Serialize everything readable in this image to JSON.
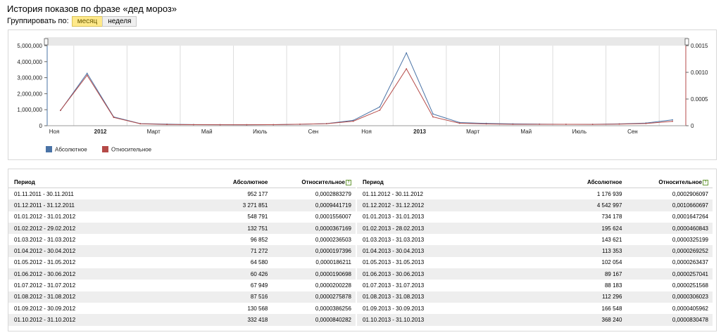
{
  "page": {
    "title": "История показов по фразе «дед мороз»",
    "group_label": "Группировать по:",
    "group_month": "месяц",
    "group_week": "неделя"
  },
  "legend": {
    "absolute": "Абсолютное",
    "relative": "Относительное"
  },
  "colors": {
    "absolute": "#4a73a6",
    "relative": "#b54a48",
    "active_button": "#ffe98a"
  },
  "chart_data": {
    "type": "line",
    "x": [
      "2011-11",
      "2011-12",
      "2012-01",
      "2012-02",
      "2012-03",
      "2012-04",
      "2012-05",
      "2012-06",
      "2012-07",
      "2012-08",
      "2012-09",
      "2012-10",
      "2012-11",
      "2012-12",
      "2013-01",
      "2013-02",
      "2013-03",
      "2013-04",
      "2013-05",
      "2013-06",
      "2013-07",
      "2013-08",
      "2013-09",
      "2013-10"
    ],
    "x_tick_labels": [
      "Ноя",
      "2012",
      "Март",
      "Май",
      "Июль",
      "Сен",
      "Ноя",
      "2013",
      "Март",
      "Май",
      "Июль",
      "Сен"
    ],
    "y_left_ticks": [
      "0",
      "1,000,000",
      "2,000,000",
      "3,000,000",
      "4,000,000",
      "5,000,000"
    ],
    "y_right_ticks": [
      "0",
      "0.0005",
      "0.0010",
      "0.0015"
    ],
    "y_left_range": [
      0,
      5000000
    ],
    "y_right_range": [
      0,
      0.0015
    ],
    "series": [
      {
        "name": "Абсолютное",
        "axis": "left",
        "values": [
          952177,
          3271851,
          548791,
          132751,
          96852,
          71272,
          64580,
          60426,
          67949,
          87516,
          130568,
          332418,
          1176939,
          4542997,
          734178,
          195624,
          143621,
          113353,
          102054,
          89167,
          88183,
          112296,
          166548,
          368240
        ]
      },
      {
        "name": "Относительное",
        "axis": "right",
        "values": [
          0.0002883279,
          0.0009441719,
          0.0001556007,
          3.67169e-05,
          2.36503e-05,
          1.97396e-05,
          1.86211e-05,
          1.90698e-05,
          2.00228e-05,
          2.75878e-05,
          3.86256e-05,
          8.40282e-05,
          0.0002906097,
          0.0010660697,
          0.0001647264,
          4.60843e-05,
          3.25199e-05,
          2.69252e-05,
          2.63437e-05,
          2.57041e-05,
          2.51568e-05,
          3.06023e-05,
          4.05962e-05,
          8.30478e-05
        ]
      }
    ],
    "grid": true,
    "legend_position": "bottom-left"
  },
  "table": {
    "headers": {
      "period": "Период",
      "absolute": "Абсолютное",
      "relative": "Относительное"
    },
    "left": [
      [
        "01.11.2011 - 30.11.2011",
        "952 177",
        "0,0002883279"
      ],
      [
        "01.12.2011 - 31.12.2011",
        "3 271 851",
        "0,0009441719"
      ],
      [
        "01.01.2012 - 31.01.2012",
        "548 791",
        "0,0001556007"
      ],
      [
        "01.02.2012 - 29.02.2012",
        "132 751",
        "0,0000367169"
      ],
      [
        "01.03.2012 - 31.03.2012",
        "96 852",
        "0,0000236503"
      ],
      [
        "01.04.2012 - 30.04.2012",
        "71 272",
        "0,0000197396"
      ],
      [
        "01.05.2012 - 31.05.2012",
        "64 580",
        "0,0000186211"
      ],
      [
        "01.06.2012 - 30.06.2012",
        "60 426",
        "0,0000190698"
      ],
      [
        "01.07.2012 - 31.07.2012",
        "67 949",
        "0,0000200228"
      ],
      [
        "01.08.2012 - 31.08.2012",
        "87 516",
        "0,0000275878"
      ],
      [
        "01.09.2012 - 30.09.2012",
        "130 568",
        "0,0000386256"
      ],
      [
        "01.10.2012 - 31.10.2012",
        "332 418",
        "0,0000840282"
      ]
    ],
    "right": [
      [
        "01.11.2012 - 30.11.2012",
        "1 176 939",
        "0,0002906097"
      ],
      [
        "01.12.2012 - 31.12.2012",
        "4 542 997",
        "0,0010660697"
      ],
      [
        "01.01.2013 - 31.01.2013",
        "734 178",
        "0,0001647264"
      ],
      [
        "01.02.2013 - 28.02.2013",
        "195 624",
        "0,0000460843"
      ],
      [
        "01.03.2013 - 31.03.2013",
        "143 621",
        "0,0000325199"
      ],
      [
        "01.04.2013 - 30.04.2013",
        "113 353",
        "0,0000269252"
      ],
      [
        "01.05.2013 - 31.05.2013",
        "102 054",
        "0,0000263437"
      ],
      [
        "01.06.2013 - 30.06.2013",
        "89 167",
        "0,0000257041"
      ],
      [
        "01.07.2013 - 31.07.2013",
        "88 183",
        "0,0000251568"
      ],
      [
        "01.08.2013 - 31.08.2013",
        "112 296",
        "0,0000306023"
      ],
      [
        "01.09.2013 - 30.09.2013",
        "166 548",
        "0,0000405962"
      ],
      [
        "01.10.2013 - 31.10.2013",
        "368 240",
        "0,0000830478"
      ]
    ]
  }
}
